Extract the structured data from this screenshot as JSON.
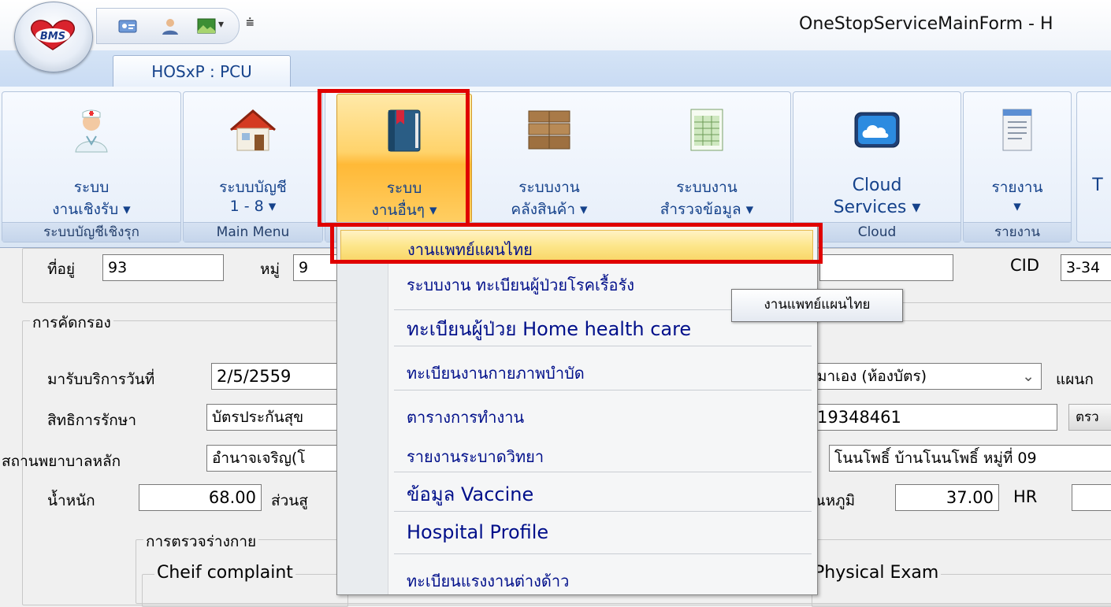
{
  "titlebar": {
    "window_title": "OneStopServiceMainForm - H",
    "app_logo_text": "BMS"
  },
  "ribbon": {
    "tab": "HOSxP : PCU",
    "groups": [
      {
        "label": "ระบบบัญชีเชิงรุก",
        "buttons": [
          {
            "line1": "ระบบ",
            "line2": "งานเชิงรับ ▾",
            "icon": "nurse-icon"
          }
        ]
      },
      {
        "label": "Main Menu",
        "buttons": [
          {
            "line1": "ระบบบัญชี",
            "line2": "1 - 8 ▾",
            "icon": "house-icon"
          }
        ]
      },
      {
        "label": "",
        "buttons": [
          {
            "line1": "ระบบ",
            "line2": "งานอื่นๆ ▾",
            "icon": "book-icon"
          }
        ]
      },
      {
        "label": "",
        "buttons": [
          {
            "line1": "ระบบงาน",
            "line2": "คลังสินค้า ▾",
            "icon": "warehouse-boxes-icon"
          }
        ]
      },
      {
        "label": "",
        "buttons": [
          {
            "line1": "ระบบงาน",
            "line2": "สำรวจข้อมูล ▾",
            "icon": "spreadsheet-icon"
          }
        ]
      },
      {
        "label": "Cloud",
        "buttons": [
          {
            "line1": "Cloud",
            "line2": "Services ▾",
            "icon": "cloud-icon"
          }
        ]
      },
      {
        "label": "รายงาน",
        "buttons": [
          {
            "line1": "รายงาน",
            "line2": "▾",
            "icon": "report-document-icon"
          }
        ]
      },
      {
        "label": "",
        "buttons": [
          {
            "line1": "T",
            "line2": "",
            "icon": ""
          }
        ]
      }
    ]
  },
  "menu": {
    "items": [
      {
        "label": "งานแพทย์แผนไทย",
        "highlighted": true
      },
      {
        "label": "ระบบงาน ทะเบียนผู้ป่วยโรคเรื้อรัง"
      },
      {
        "label": "ทะเบียนผู้ป่วย Home health care"
      },
      {
        "label": "ทะเบียนงานกายภาพบำบัด"
      },
      {
        "label": "ตารางการทำงาน"
      },
      {
        "label": "รายงานระบาดวิทยา"
      },
      {
        "label": "ข้อมูล Vaccine"
      },
      {
        "label": "Hospital Profile"
      },
      {
        "label": "ทะเบียนแรงงานต่างด้าว"
      }
    ],
    "tooltip": "งานแพทย์แผนไทย"
  },
  "form": {
    "address_label": "ที่อยู่",
    "address_value": "93",
    "moo_label": "หมู่",
    "moo_value": "9",
    "cid_label": "CID",
    "cid_value": "3-34",
    "screening_group": "การคัดกรอง",
    "visit_date_label": "มารับบริการวันที่",
    "visit_date_value": "2/5/2559",
    "department_value": "มาเอง (ห้องบัตร)",
    "dept_label_partial": "แผนก",
    "right_label": "สิทธิการรักษา",
    "right_value": "บัตรประกันสุข",
    "right_no_value": "19348461",
    "check_btn_partial": "ตรว",
    "main_hospital_label": "สถานพยาบาลหลัก",
    "main_hospital_value": "อำนาจเจริญ(โ",
    "address_full_value": "โนนโพธิ์ บ้านโนนโพธิ์ หมู่ที่ 09",
    "weight_label": "น้ำหนัก",
    "weight_value": "68.00",
    "height_label_partial": "ส่วนสู",
    "temp_label_partial": "ณหภูมิ",
    "temp_value": "37.00",
    "hr_label": "HR",
    "exam_group": "การตรวจร่างกาย",
    "chief_complaint_label": "Cheif complaint",
    "physical_exam_label": "Physical Exam"
  },
  "colors": {
    "highlight_box": "#e00000",
    "ribbon_active": "#ffc24a",
    "menu_text": "#000f8a"
  }
}
